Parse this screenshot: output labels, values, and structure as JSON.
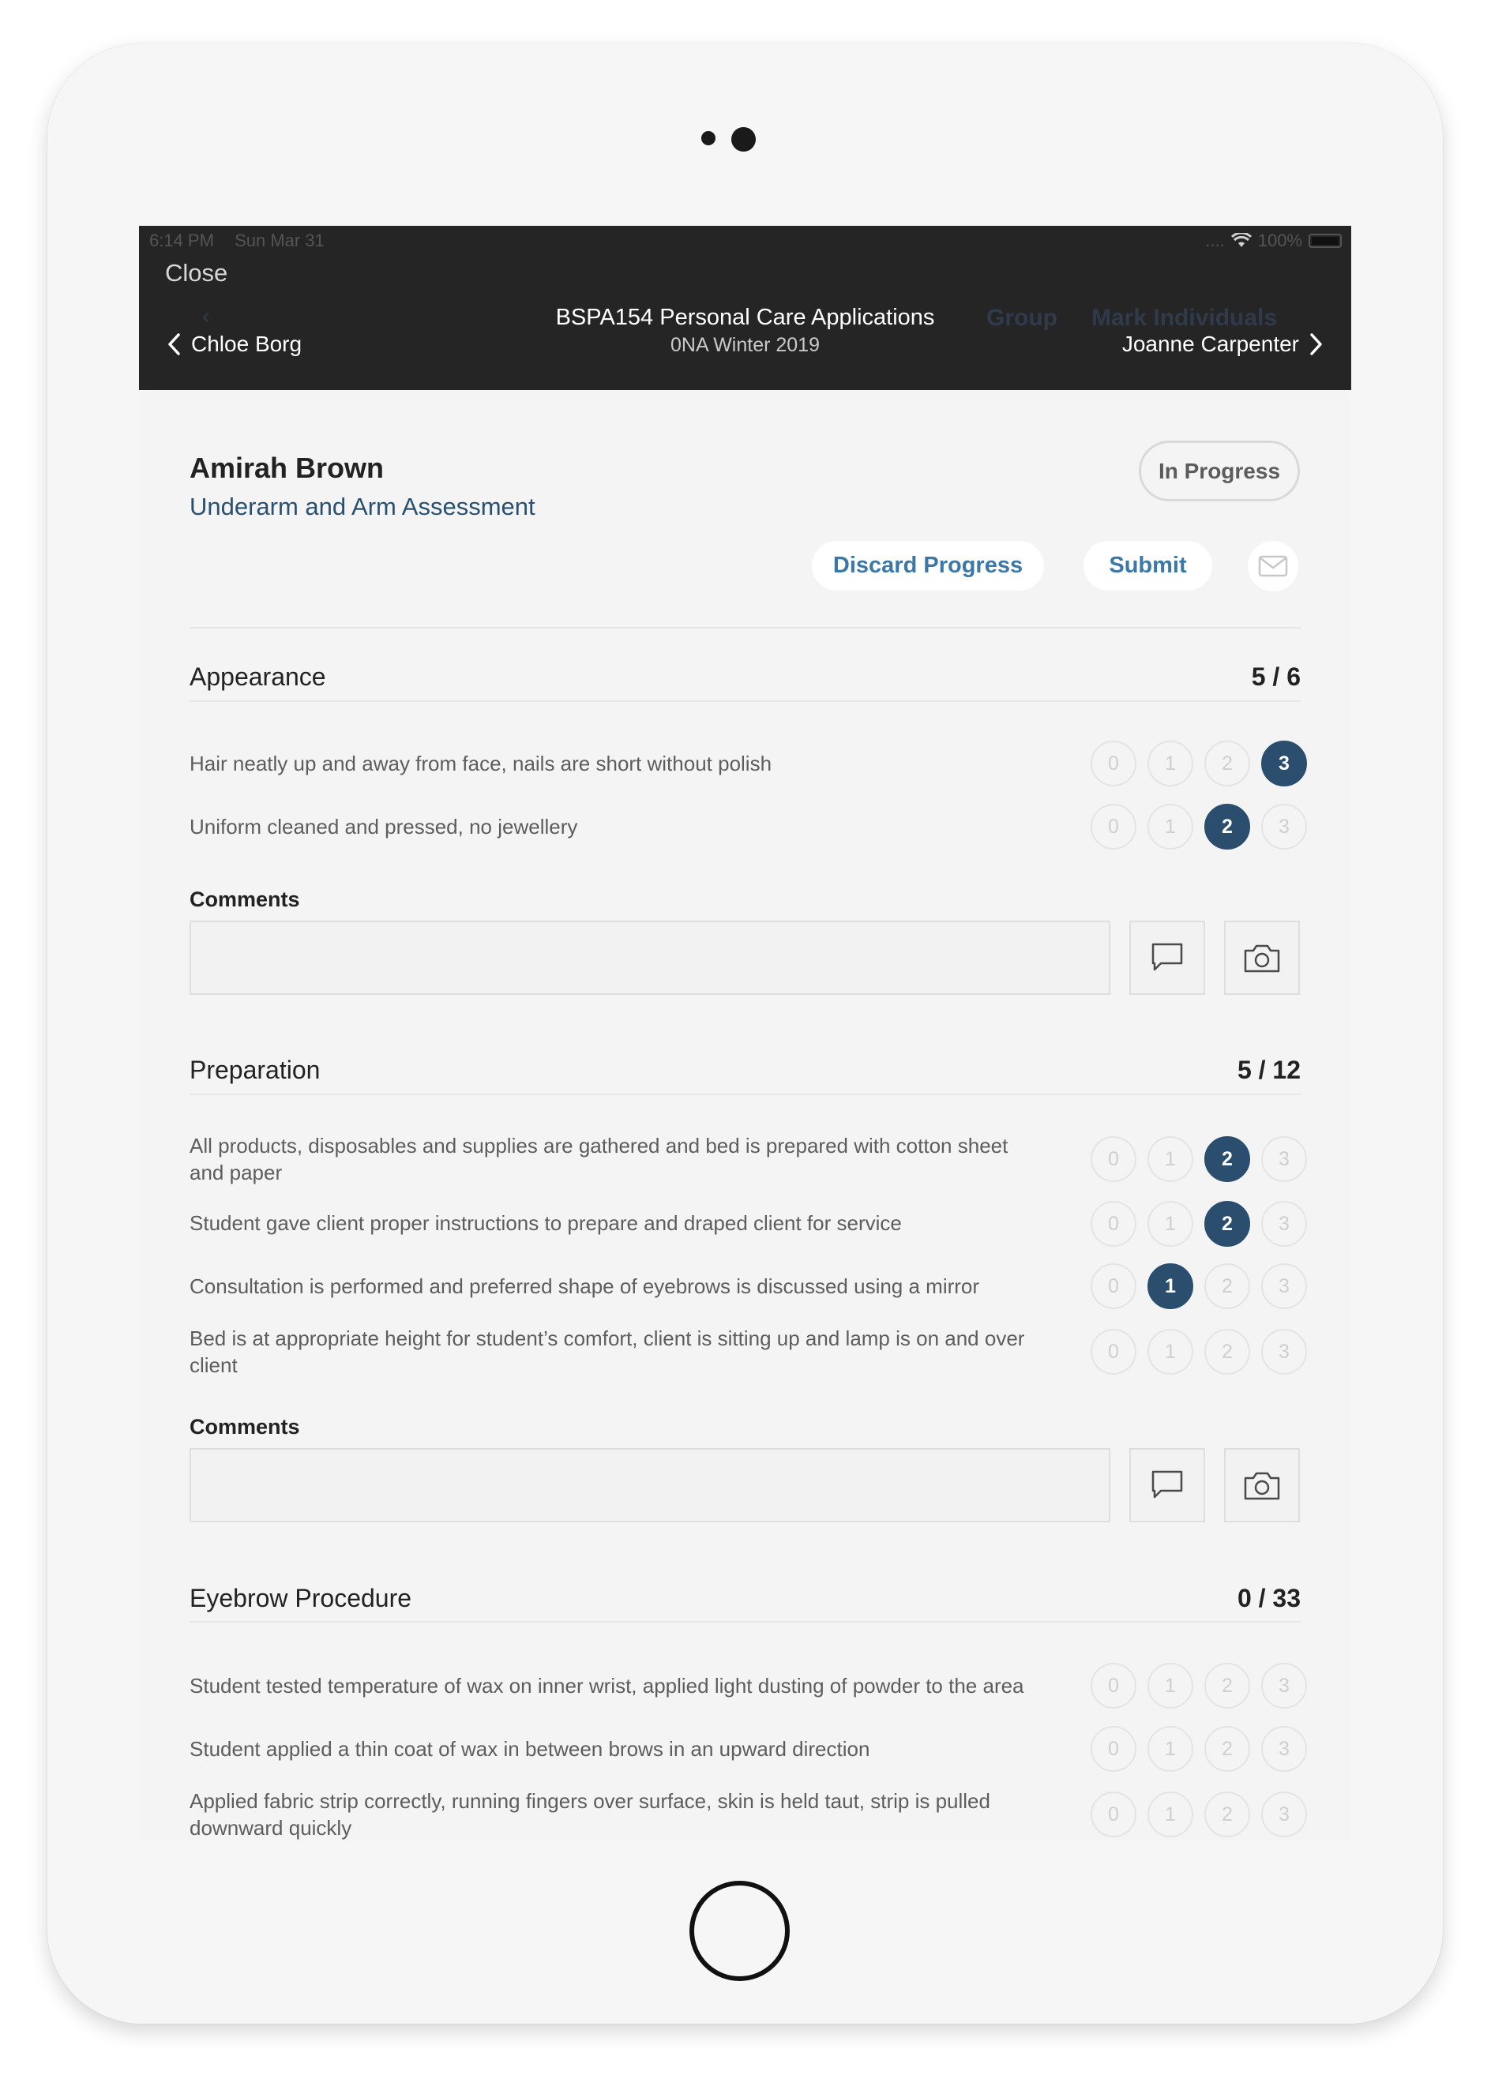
{
  "status_bar": {
    "time": "6:14 PM",
    "date": "Sun Mar 31",
    "signal": "....",
    "battery": "100%"
  },
  "nav": {
    "close_label": "Close",
    "ghost_left": "‹",
    "ghost_group": "Group",
    "ghost_mark": "Mark Individuals",
    "title": "BSPA154 Personal Care Applications",
    "subtitle": "0NA Winter 2019",
    "prev_student": "Chloe Borg",
    "next_student": "Joanne Carpenter"
  },
  "header": {
    "student_name": "Amirah Brown",
    "assessment_name": "Underarm and Arm Assessment",
    "status_badge": "In Progress",
    "discard_label": "Discard Progress",
    "submit_label": "Submit"
  },
  "score_options": [
    "0",
    "1",
    "2",
    "3"
  ],
  "comments_label": "Comments",
  "sections": [
    {
      "title": "Appearance",
      "score": "5 / 6",
      "criteria": [
        {
          "text": "Hair neatly up and away from face, nails are short without polish",
          "selected": 3
        },
        {
          "text": "Uniform cleaned and pressed, no jewellery",
          "selected": 2
        }
      ]
    },
    {
      "title": "Preparation",
      "score": "5 / 12",
      "criteria": [
        {
          "text": "All products, disposables and supplies are gathered and bed is prepared with cotton sheet and paper",
          "selected": 2
        },
        {
          "text": "Student gave client proper instructions to prepare and draped client for service",
          "selected": 2
        },
        {
          "text": "Consultation is performed and preferred shape of eyebrows is discussed using a mirror",
          "selected": 1
        },
        {
          "text": "Bed is at appropriate height for student’s comfort, client is sitting up and lamp is on and over client",
          "selected": null
        }
      ]
    },
    {
      "title": "Eyebrow Procedure",
      "score": "0 / 33",
      "criteria": [
        {
          "text": "Student tested temperature of wax on inner wrist, applied light dusting of powder to the area",
          "selected": null
        },
        {
          "text": "Student applied a thin coat of wax in between brows in an upward direction",
          "selected": null
        },
        {
          "text": "Applied fabric strip correctly, running fingers over surface, skin is held taut, strip is pulled downward quickly",
          "selected": null
        }
      ]
    }
  ],
  "colors": {
    "selected": "#2b4e6e",
    "accent": "#3c78a7",
    "nav_background": "#252525"
  }
}
